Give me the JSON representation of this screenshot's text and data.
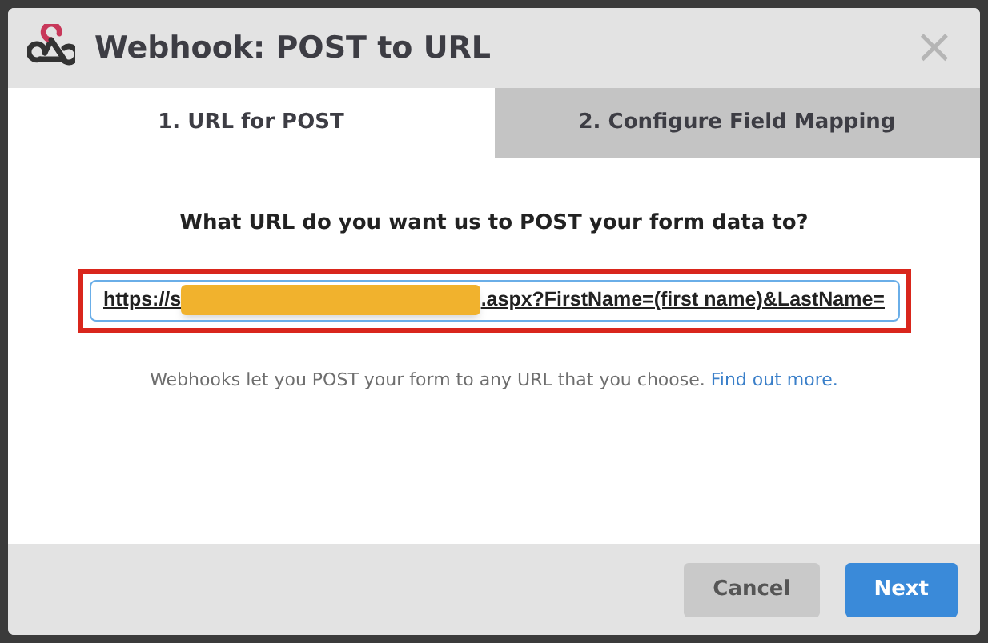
{
  "dialog": {
    "title": "Webhook: POST to URL",
    "close": "×"
  },
  "tabs": [
    {
      "label": "1. URL for POST",
      "selected": true
    },
    {
      "label": "2. Configure Field Mapping",
      "selected": false
    }
  ],
  "question": "What URL do you want us to POST your form data to?",
  "url_field": {
    "value_start": "https://s",
    "redacted": true,
    "value_end": ".aspx?FirstName=(first name)&LastName=",
    "highlighted": true
  },
  "help": {
    "text": "Webhooks let you POST your form to any URL that you choose.",
    "link": "Find out more."
  },
  "buttons": [
    {
      "label": "Cancel",
      "kind": "secondary"
    },
    {
      "label": "Next",
      "kind": "primary"
    }
  ]
}
